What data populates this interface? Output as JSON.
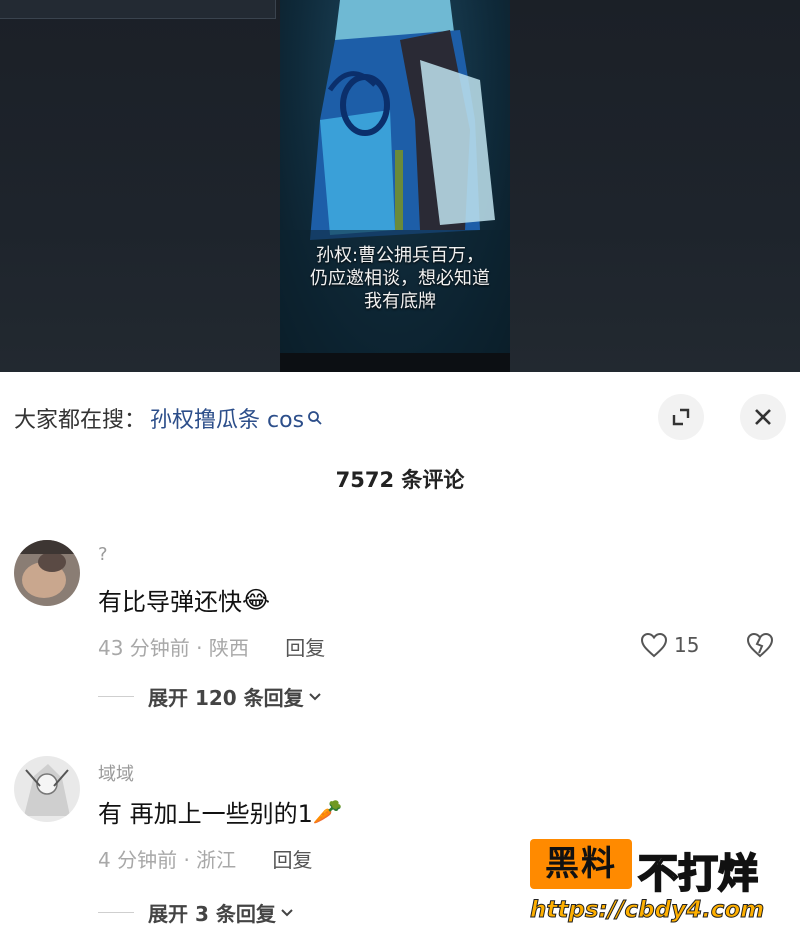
{
  "video": {
    "caption_lines": [
      "孙权:曹公拥兵百万，",
      "仍应邀相谈，想必知道",
      "我有底牌"
    ]
  },
  "panel": {
    "search_prefix": "大家都在搜：",
    "search_query": "孙权撸瓜条 cos",
    "comment_count": "7572 条评论"
  },
  "comments": [
    {
      "username": "?",
      "text": "有比导弹还快",
      "emoji": "😂",
      "time": "43 分钟前 · 陕西",
      "reply_label": "回复",
      "likes": "15",
      "expand_label": "展开 120 条回复"
    },
    {
      "username": "域域",
      "text": "有 再加上一些别的1",
      "emoji": "🥕",
      "time": "4 分钟前 · 浙江",
      "reply_label": "回复",
      "expand_label": "展开 3 条回复"
    }
  ],
  "watermark": {
    "badge": "黑料",
    "title": "不打烊",
    "url": "https://cbdy4.com"
  },
  "colors": {
    "link_blue": "#2c4e8a",
    "brand_orange": "#ff8a00"
  }
}
